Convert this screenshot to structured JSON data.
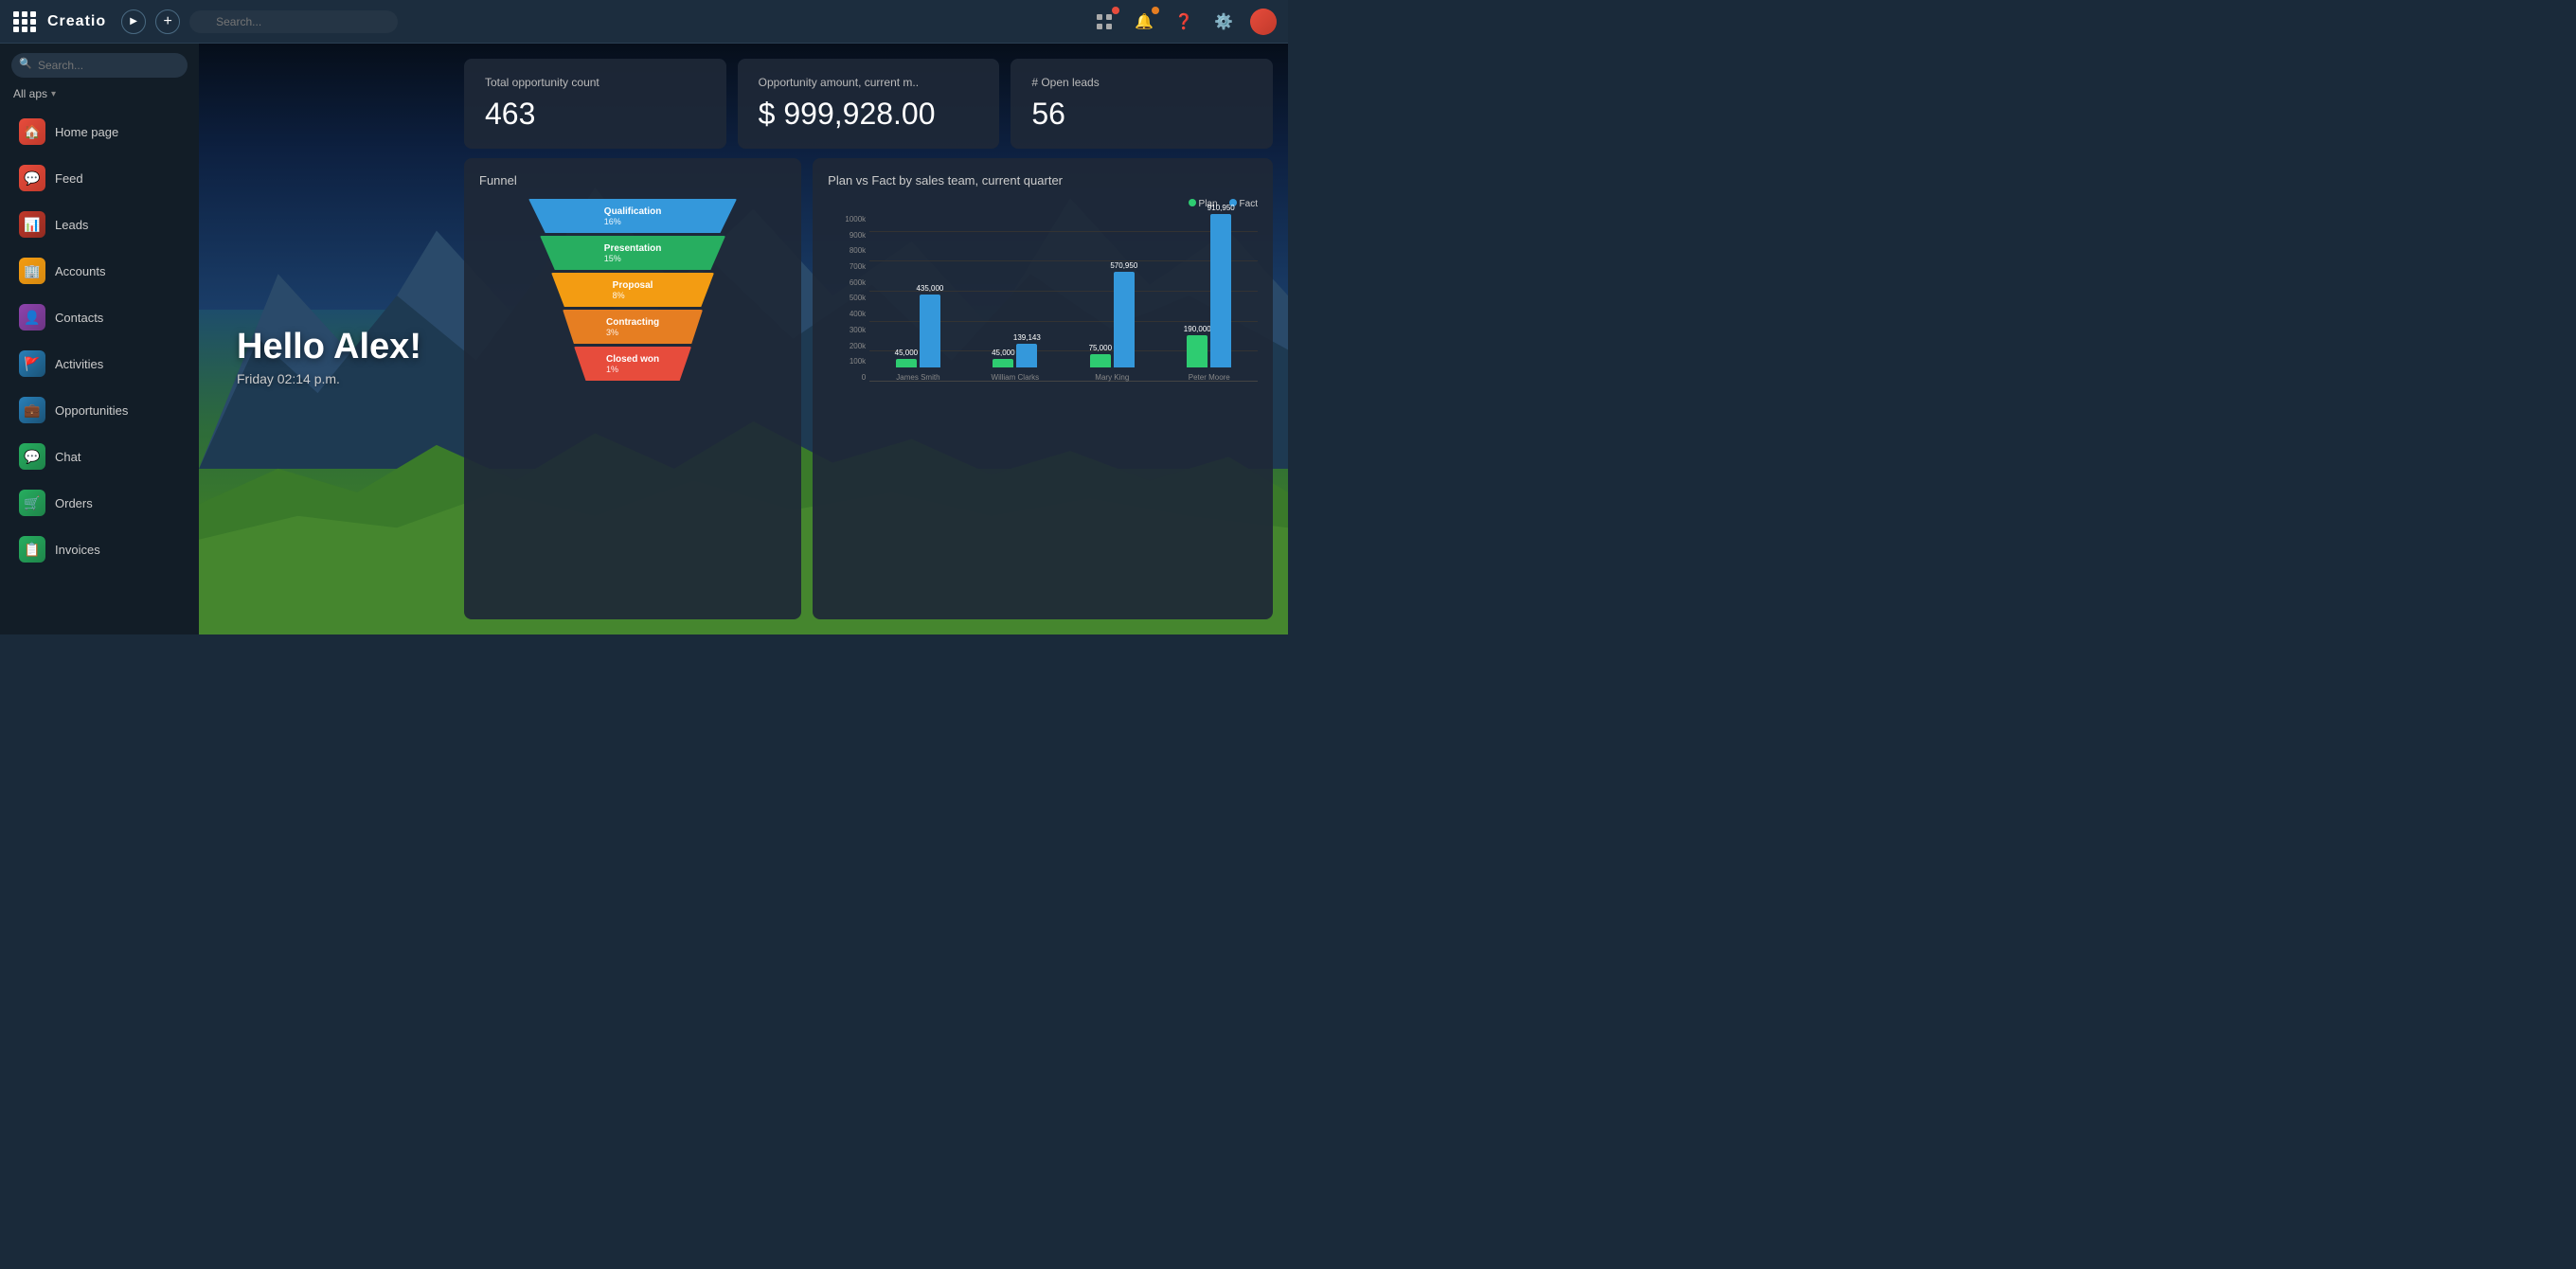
{
  "topbar": {
    "logo": "Creatio",
    "search_placeholder": "Search...",
    "right_icons": [
      "apps-icon",
      "bell-icon",
      "help-icon",
      "settings-icon",
      "avatar-icon"
    ]
  },
  "sidebar": {
    "search_placeholder": "Search...",
    "filter_label": "All aps",
    "items": [
      {
        "id": "home-page",
        "label": "Home page",
        "icon": "home"
      },
      {
        "id": "feed",
        "label": "Feed",
        "icon": "feed"
      },
      {
        "id": "leads",
        "label": "Leads",
        "icon": "leads"
      },
      {
        "id": "accounts",
        "label": "Accounts",
        "icon": "accounts"
      },
      {
        "id": "contacts",
        "label": "Contacts",
        "icon": "contacts"
      },
      {
        "id": "activities",
        "label": "Activities",
        "icon": "activities"
      },
      {
        "id": "opportunities",
        "label": "Opportunities",
        "icon": "opportunities"
      },
      {
        "id": "chat",
        "label": "Chat",
        "icon": "chat"
      },
      {
        "id": "orders",
        "label": "Orders",
        "icon": "orders"
      },
      {
        "id": "invoices",
        "label": "Invoices",
        "icon": "invoices"
      }
    ]
  },
  "hello": {
    "greeting": "Hello Alex!",
    "datetime": "Friday 02:14 p.m."
  },
  "stats": [
    {
      "label": "Total opportunity count",
      "value": "463"
    },
    {
      "label": "Opportunity amount, current m..",
      "value": "$ 999,928.00"
    },
    {
      "label": "# Open leads",
      "value": "56"
    }
  ],
  "funnel": {
    "title": "Funnel",
    "segments": [
      {
        "label": "Qualification",
        "pct": "16%",
        "color": "#3498db"
      },
      {
        "label": "Presentation",
        "pct": "15%",
        "color": "#27ae60"
      },
      {
        "label": "Proposal",
        "pct": "8%",
        "color": "#f39c12"
      },
      {
        "label": "Contracting",
        "pct": "3%",
        "color": "#e67e22"
      },
      {
        "label": "Closed won",
        "pct": "1%",
        "color": "#e74c3c"
      }
    ]
  },
  "bar_chart": {
    "title": "Plan vs Fact by sales team, current quarter",
    "legend": [
      {
        "label": "Plan",
        "color": "#2ecc71"
      },
      {
        "label": "Fact",
        "color": "#3498db"
      }
    ],
    "y_axis": [
      "1000k",
      "900k",
      "800k",
      "700k",
      "600k",
      "500k",
      "400k",
      "300k",
      "200k",
      "100k",
      "0"
    ],
    "groups": [
      {
        "name": "James Smith",
        "plan": {
          "value": 45000,
          "label": "45,000",
          "height": 9
        },
        "fact": {
          "value": 435000,
          "label": "435,000",
          "height": 87
        }
      },
      {
        "name": "William Clarks",
        "plan": {
          "value": 45000,
          "label": "45,000",
          "height": 9
        },
        "fact": {
          "value": 139143,
          "label": "139,143",
          "height": 28
        }
      },
      {
        "name": "Mary King",
        "plan": {
          "value": 75000,
          "label": "75,000",
          "height": 15
        },
        "fact": {
          "value": 570950,
          "label": "570,950",
          "height": 114
        }
      },
      {
        "name": "Peter Moore",
        "plan": {
          "value": 190000,
          "label": "190,000",
          "height": 38
        },
        "fact": {
          "value": 910950,
          "label": "910,950",
          "height": 182
        }
      }
    ]
  }
}
